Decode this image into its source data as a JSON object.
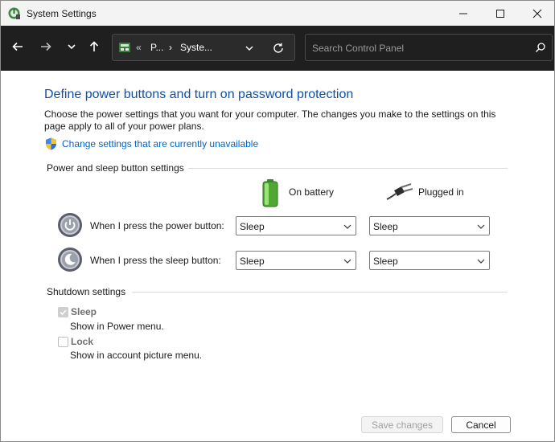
{
  "window": {
    "title": "System Settings",
    "icon": "power-options-icon"
  },
  "nav": {
    "back_icon": "arrow-left-icon",
    "forward_icon": "arrow-right-icon",
    "recent_icon": "chevron-down-icon",
    "up_icon": "arrow-up-icon",
    "address": {
      "overflow": "«",
      "crumb1": "P...",
      "separator": "›",
      "crumb2": "Syste..."
    },
    "search_placeholder": "Search Control Panel"
  },
  "page": {
    "title": "Define power buttons and turn on password protection",
    "description": "Choose the power settings that you want for your computer. The changes you make to the settings on this page apply to all of your power plans.",
    "change_link": "Change settings that are currently unavailable"
  },
  "power_sleep": {
    "group_label": "Power and sleep button settings",
    "col_battery": "On battery",
    "col_plugged": "Plugged in",
    "rows": [
      {
        "label": "When I press the power button:",
        "battery": "Sleep",
        "plugged": "Sleep"
      },
      {
        "label": "When I press the sleep button:",
        "battery": "Sleep",
        "plugged": "Sleep"
      }
    ]
  },
  "shutdown": {
    "group_label": "Shutdown settings",
    "items": [
      {
        "label": "Sleep",
        "sub": "Show in Power menu.",
        "checked": true
      },
      {
        "label": "Lock",
        "sub": "Show in account picture menu.",
        "checked": false
      }
    ]
  },
  "footer": {
    "save_label": "Save changes",
    "cancel_label": "Cancel"
  },
  "colors": {
    "title_blue": "#0f4fa8",
    "link_blue": "#0563c1",
    "navbar_bg": "#1f1f1f"
  }
}
